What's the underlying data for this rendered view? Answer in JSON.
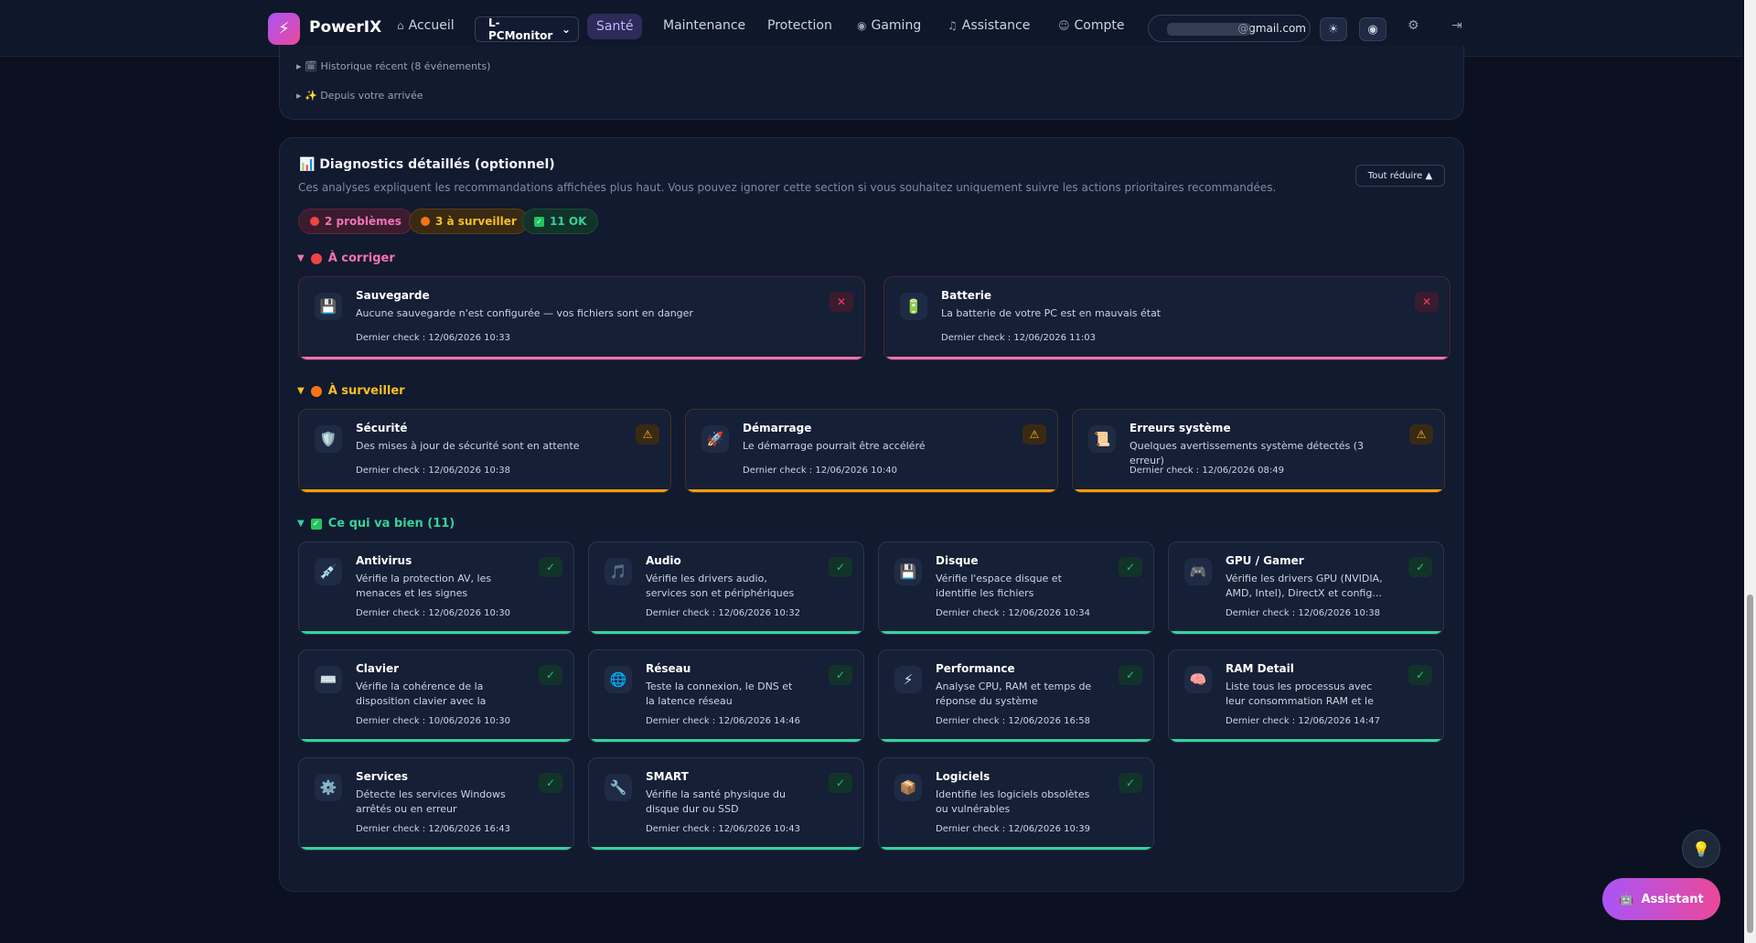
{
  "topbar": {
    "brand": "PowerIX",
    "nav": {
      "accueil": "Accueil",
      "sante": "Santé",
      "maintenance": "Maintenance",
      "protection": "Protection",
      "gaming": "Gaming",
      "assistance": "Assistance",
      "compte": "Compte"
    },
    "device_select": "L-PCMonitor",
    "email": "@gmail.com"
  },
  "history": {
    "recent": "▸ 🗓 Historique récent (8 événements)",
    "since": "▸ ✨ Depuis votre arrivée"
  },
  "diag": {
    "title": "📊 Diagnostics détaillés (optionnel)",
    "description": "Ces analyses expliquent les recommandations affichées plus haut. Vous pouvez ignorer cette section si vous souhaitez uniquement suivre les actions prioritaires recommandées.",
    "collapse_all": "Tout réduire ▲",
    "pills": {
      "problems": "2 problèmes",
      "watch": "3 à surveiller",
      "ok": "11 OK"
    },
    "sections": {
      "fix": "À corriger",
      "watch": "À surveiller",
      "ok": "Ce qui va bien (11)"
    },
    "fix_cards": [
      {
        "icon": "💾",
        "title": "Sauvegarde",
        "sub": "Aucune sauvegarde n'est configurée — vos fichiers sont en danger",
        "check": "Dernier check : 12/06/2026 10:33"
      },
      {
        "icon": "🔋",
        "title": "Batterie",
        "sub": "La batterie de votre PC est en mauvais état",
        "check": "Dernier check : 12/06/2026 11:03"
      }
    ],
    "watch_cards": [
      {
        "icon": "🛡️",
        "title": "Sécurité",
        "sub": "Des mises à jour de sécurité sont en attente",
        "check": "Dernier check : 12/06/2026 10:38"
      },
      {
        "icon": "🚀",
        "title": "Démarrage",
        "sub": "Le démarrage pourrait être accéléré",
        "check": "Dernier check : 12/06/2026 10:40"
      },
      {
        "icon": "📜",
        "title": "Erreurs système",
        "sub": "Quelques avertissements système détectés (3 erreur)",
        "check": "Dernier check : 12/06/2026 08:49"
      }
    ],
    "ok_cards": [
      {
        "icon": "💉",
        "title": "Antivirus",
        "sub": "Vérifie la protection AV, les menaces et les signes d'infection",
        "check": "Dernier check : 12/06/2026 10:30"
      },
      {
        "icon": "🎵",
        "title": "Audio",
        "sub": "Vérifie les drivers audio, services son et périphériques",
        "check": "Dernier check : 12/06/2026 10:32"
      },
      {
        "icon": "💾",
        "title": "Disque",
        "sub": "Vérifie l'espace disque et identifie les fichiers volumineux",
        "check": "Dernier check : 12/06/2026 10:34"
      },
      {
        "icon": "🎮",
        "title": "GPU / Gamer",
        "sub": "Vérifie les drivers GPU (NVIDIA, AMD, Intel), DirectX et config...",
        "check": "Dernier check : 12/06/2026 10:38"
      },
      {
        "icon": "⌨️",
        "title": "Clavier",
        "sub": "Vérifie la cohérence de la disposition clavier avec la langue...",
        "check": "Dernier check : 10/06/2026 10:30"
      },
      {
        "icon": "🌐",
        "title": "Réseau",
        "sub": "Teste la connexion, le DNS et la latence réseau",
        "check": "Dernier check : 12/06/2026 14:46"
      },
      {
        "icon": "⚡",
        "title": "Performance",
        "sub": "Analyse CPU, RAM et temps de réponse du système",
        "check": "Dernier check : 12/06/2026 16:58"
      },
      {
        "icon": "🧠",
        "title": "RAM Detail",
        "sub": "Liste tous les processus avec leur consommation RAM et le cache...",
        "check": "Dernier check : 12/06/2026 14:47"
      },
      {
        "icon": "⚙️",
        "title": "Services",
        "sub": "Détecte les services Windows arrêtés ou en erreur",
        "check": "Dernier check : 12/06/2026 16:43"
      },
      {
        "icon": "🔧",
        "title": "SMART",
        "sub": "Vérifie la santé physique du disque dur ou SSD",
        "check": "Dernier check : 12/06/2026 10:43"
      },
      {
        "icon": "📦",
        "title": "Logiciels",
        "sub": "Identifie les logiciels obsolètes ou vulnérables",
        "check": "Dernier check : 12/06/2026 10:39"
      }
    ]
  },
  "assistant": {
    "label": "Assistant"
  },
  "colors": {
    "fix": "#f472b6",
    "watch": "#f59e0b",
    "ok": "#34d399"
  }
}
